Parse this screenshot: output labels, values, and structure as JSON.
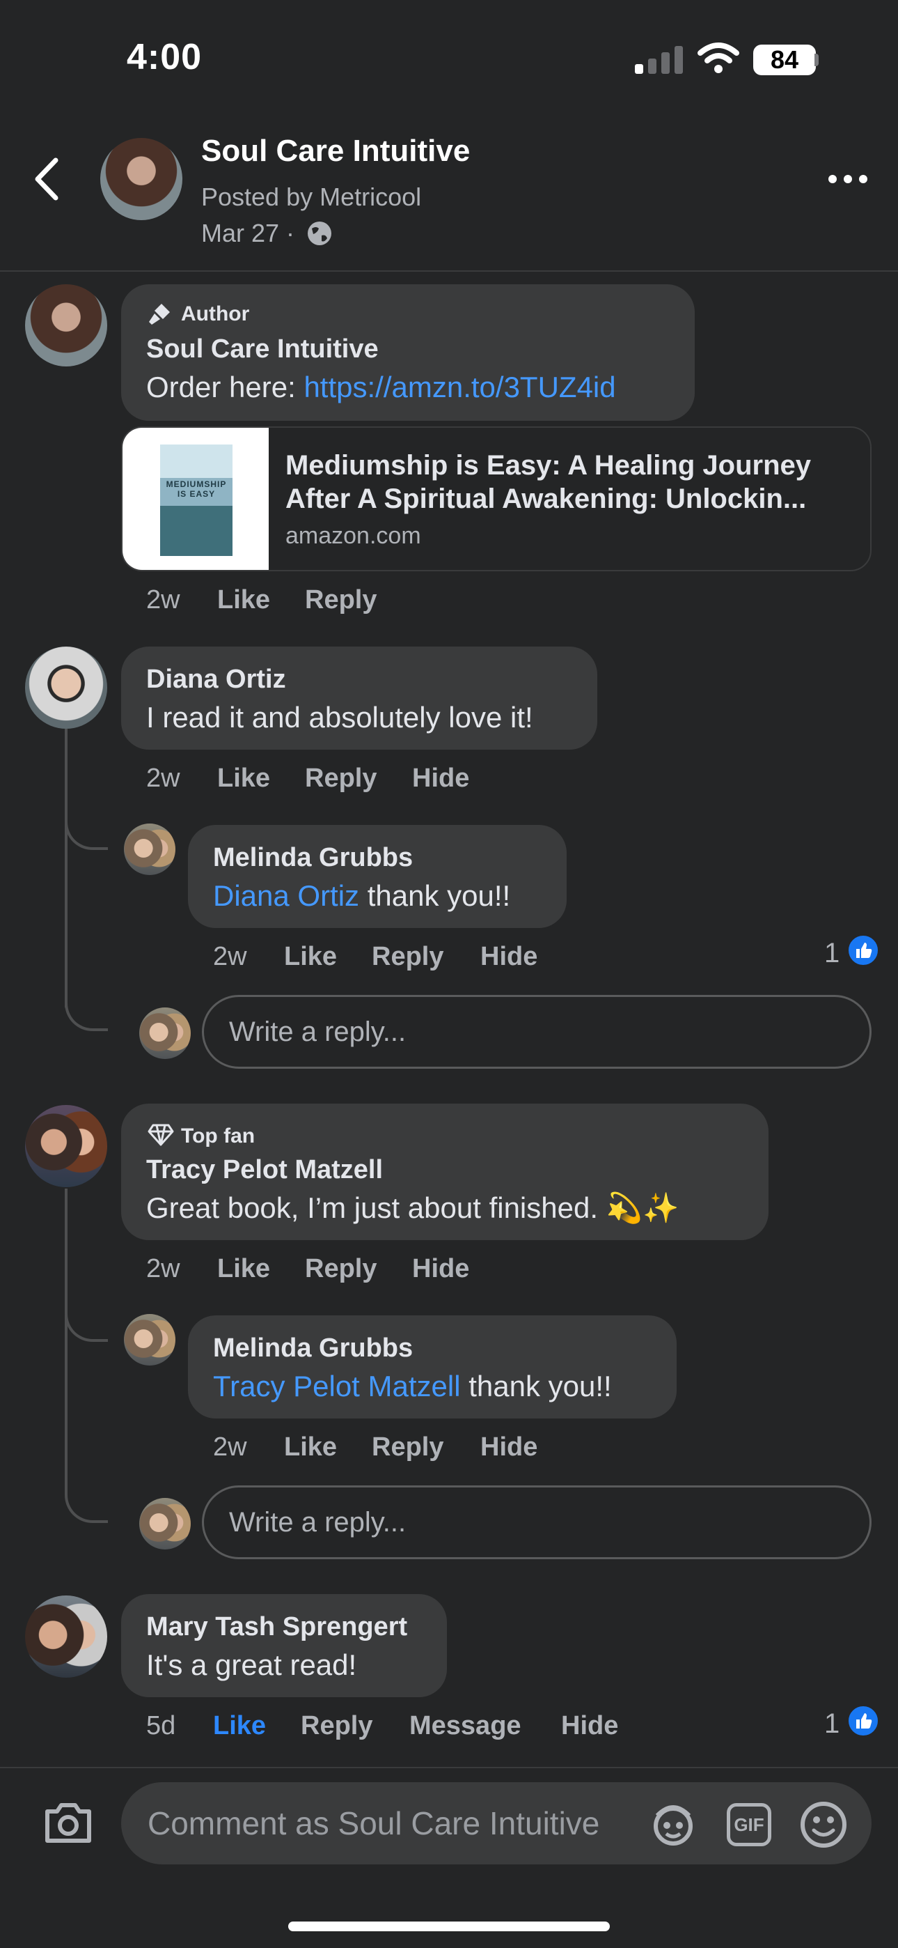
{
  "status_bar": {
    "time": "4:00",
    "battery": "84"
  },
  "header": {
    "title": "Soul Care Intuitive",
    "posted_by": "Posted by Metricool",
    "date": "Mar 27 ·"
  },
  "comments": [
    {
      "badge": "Author",
      "name": "Soul Care Intuitive",
      "text_prefix": "Order here: ",
      "link": "https://amzn.to/3TUZ4id",
      "preview": {
        "title": "Mediumship is Easy: A Healing Journey After A Spiritual Awakening: Unlockin...",
        "domain": "amazon.com",
        "book_cover_text": "MEDIUMSHIP IS EASY"
      },
      "time": "2w",
      "like": "Like",
      "reply": "Reply"
    },
    {
      "name": "Diana Ortiz",
      "text": "I read it and absolutely love it!",
      "time": "2w",
      "like": "Like",
      "reply": "Reply",
      "hide": "Hide",
      "replies": [
        {
          "name": "Melinda Grubbs",
          "mention": "Diana Ortiz",
          "text": " thank you!!",
          "time": "2w",
          "like": "Like",
          "reply": "Reply",
          "hide": "Hide",
          "reactions": "1"
        }
      ],
      "reply_placeholder": "Write a reply..."
    },
    {
      "badge": "Top fan",
      "name": "Tracy Pelot Matzell",
      "text": "Great book, I’m just about finished. 💫✨",
      "time": "2w",
      "like": "Like",
      "reply": "Reply",
      "hide": "Hide",
      "replies": [
        {
          "name": "Melinda Grubbs",
          "mention": "Tracy Pelot Matzell",
          "text": " thank you!!",
          "time": "2w",
          "like": "Like",
          "reply": "Reply",
          "hide": "Hide"
        }
      ],
      "reply_placeholder": "Write a reply..."
    },
    {
      "name": "Mary Tash Sprengert",
      "text": "It's a great read!",
      "time": "5d",
      "like": "Like",
      "reply": "Reply",
      "message": "Message",
      "hide": "Hide",
      "reactions": "1"
    }
  ],
  "composer": {
    "placeholder": "Comment as Soul Care Intuitive",
    "gif_label": "GIF"
  },
  "colors": {
    "background": "#242526",
    "bubble": "#3a3b3c",
    "link": "#4599ff",
    "like_active": "#2d88ff"
  }
}
